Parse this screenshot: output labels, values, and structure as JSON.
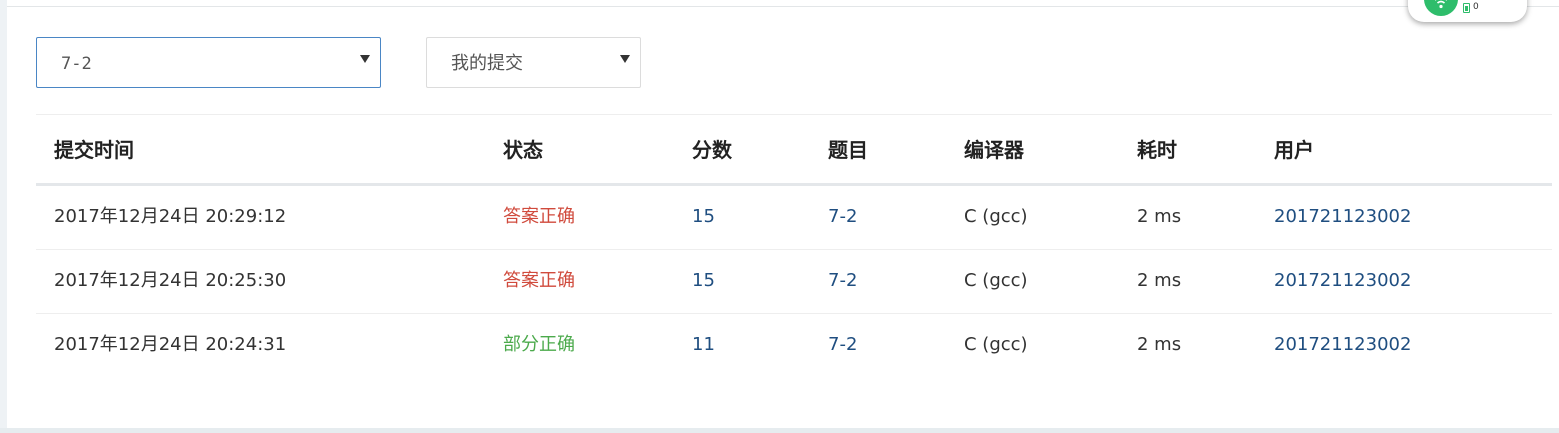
{
  "filters": {
    "problem": "7-2",
    "scope": "我的提交"
  },
  "widget": {
    "count": "0",
    "accent": "#2ebd6b"
  },
  "table": {
    "headers": {
      "time": "提交时间",
      "status": "状态",
      "score": "分数",
      "problem": "题目",
      "compiler": "编译器",
      "elapsed": "耗时",
      "user": "用户"
    },
    "rows": [
      {
        "time": "2017年12月24日 20:29:12",
        "status": "答案正确",
        "score": "15",
        "problem": "7-2",
        "compiler": "C (gcc)",
        "elapsed": "2 ms",
        "user": "201721123002"
      },
      {
        "time": "2017年12月24日 20:25:30",
        "status": "答案正确",
        "score": "15",
        "problem": "7-2",
        "compiler": "C (gcc)",
        "elapsed": "2 ms",
        "user": "201721123002"
      },
      {
        "time": "2017年12月24日 20:24:31",
        "status": "部分正确",
        "score": "11",
        "problem": "7-2",
        "compiler": "C (gcc)",
        "elapsed": "2 ms",
        "user": "201721123002"
      }
    ]
  },
  "colors": {
    "status_accepted": "#d04a3c",
    "status_partial": "#4caa4c",
    "link": "#1f4e80",
    "focus_border": "#4a86c5"
  }
}
